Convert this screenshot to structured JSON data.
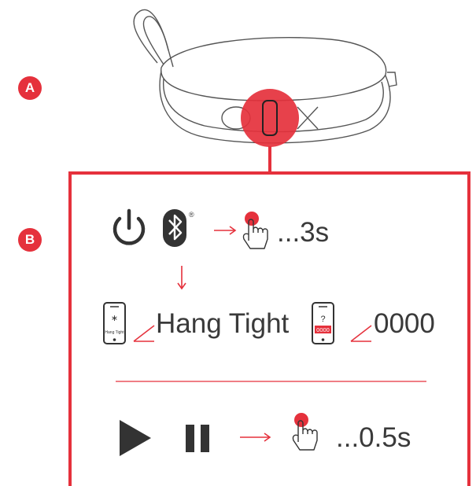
{
  "colors": {
    "accent": "#e5313c",
    "ink": "#3a3a3a",
    "line": "#555555"
  },
  "steps": {
    "a_label": "A",
    "b_label": "B"
  },
  "pairing": {
    "icons": [
      "power-icon",
      "bluetooth-icon",
      "arrow-right-icon",
      "press-hand-icon"
    ],
    "registered_mark": "®",
    "hold_time": "...3s",
    "down_arrow": "↓"
  },
  "phone_screen": {
    "bt_glyph": "∗",
    "screen_text": "Hang Tight",
    "status_text": "Hang Tight"
  },
  "pin": {
    "question_mark": "?",
    "screen_code": "0000",
    "code_text": "0000"
  },
  "playback": {
    "icons": [
      "play-icon",
      "pause-icon",
      "arrow-right-icon",
      "press-hand-icon"
    ],
    "hold_time": "...0.5s"
  }
}
